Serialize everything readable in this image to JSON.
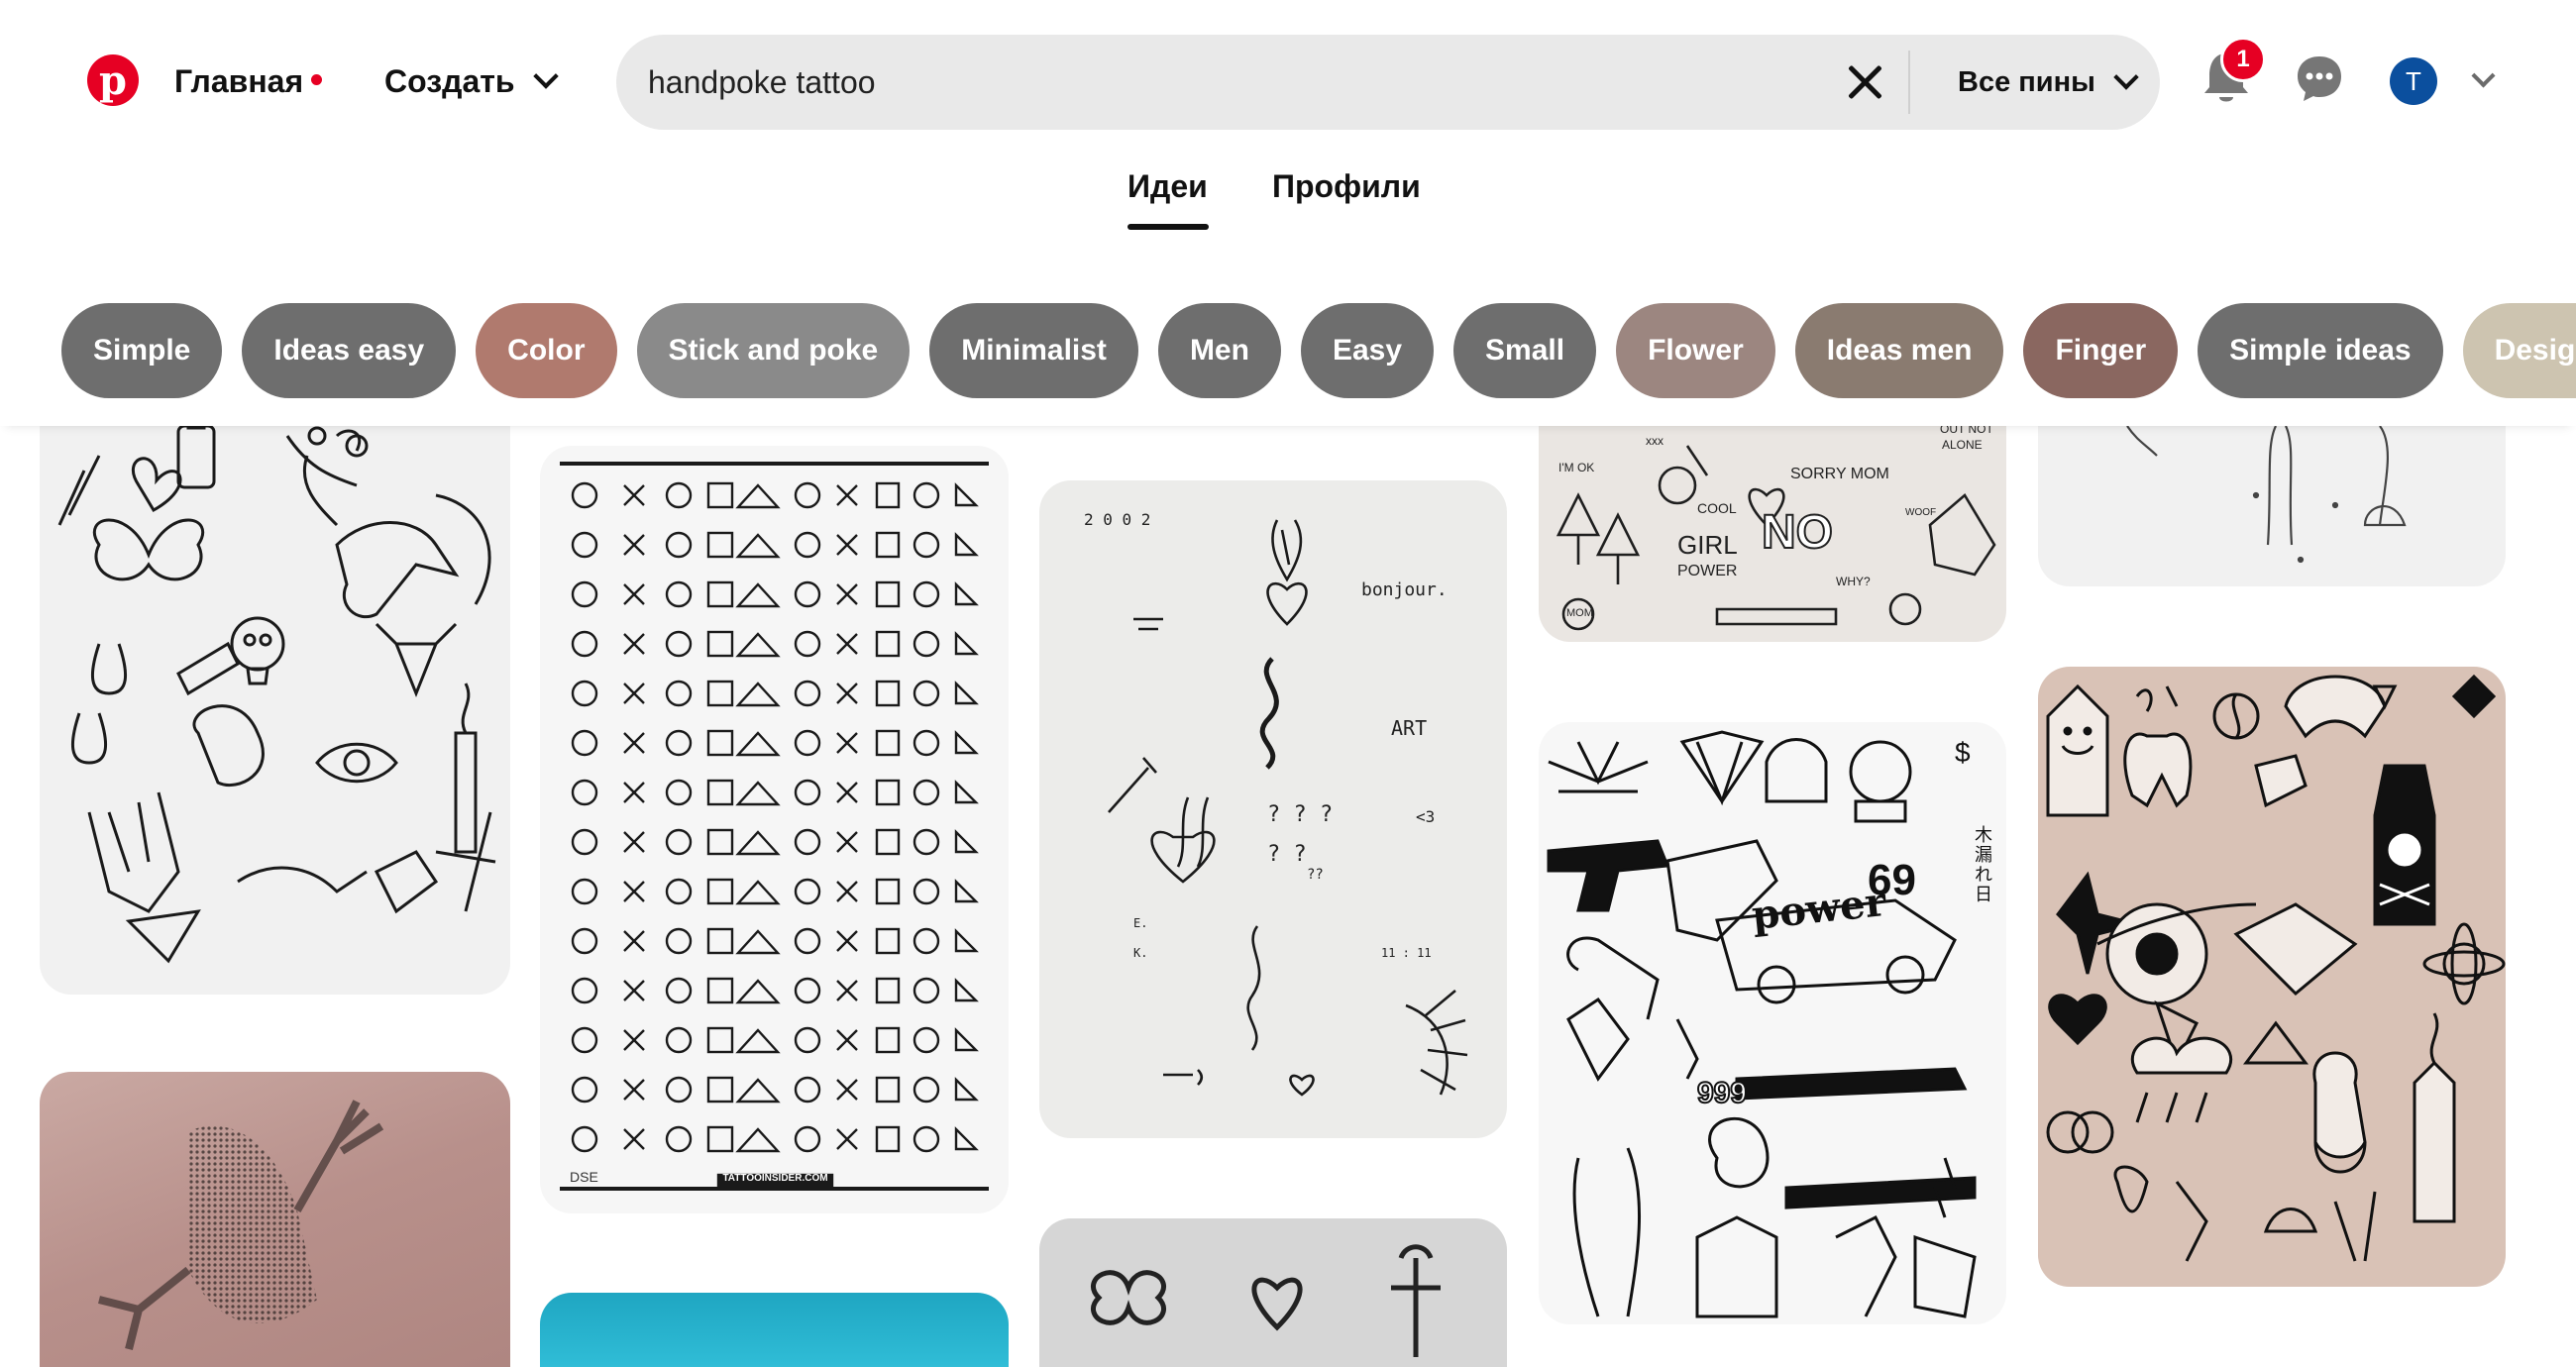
{
  "header": {
    "logo_icon": "pinterest-logo-icon",
    "nav_home": "Главная",
    "nav_create": "Создать",
    "search_value": "handpoke tattoo",
    "search_filter": "Все пины",
    "notification_count": "1",
    "avatar_initial": "T"
  },
  "tabs": [
    {
      "label": "Идеи",
      "selected": true
    },
    {
      "label": "Профили",
      "selected": false
    }
  ],
  "chips": [
    {
      "label": "Simple",
      "color": "#6e6e6e"
    },
    {
      "label": "Ideas easy",
      "color": "#6e6e6e"
    },
    {
      "label": "Color",
      "color": "#b07a6e"
    },
    {
      "label": "Stick and poke",
      "color": "#8a8a8a"
    },
    {
      "label": "Minimalist",
      "color": "#6e6e6e"
    },
    {
      "label": "Men",
      "color": "#6e6e6e"
    },
    {
      "label": "Easy",
      "color": "#6e6e6e"
    },
    {
      "label": "Small",
      "color": "#6e6e6e"
    },
    {
      "label": "Flower",
      "color": "#9c8680"
    },
    {
      "label": "Ideas men",
      "color": "#8a7b70"
    },
    {
      "label": "Finger",
      "color": "#8a6760"
    },
    {
      "label": "Simple ideas",
      "color": "#6e6e6e"
    },
    {
      "label": "Design",
      "color": "#cdc4b0"
    }
  ],
  "pins": {
    "sketch_sheet_texts": [
      "2 0 0 2",
      "bonjour.",
      "ART",
      "<3",
      "E.",
      "K.",
      "11 : 11",
      "? ? ?",
      "? ?",
      "??"
    ],
    "flash_sheet_footer": "TATTOOINSIDER.COM",
    "flash_sheet_initials": "DSE",
    "grunge_sheet_texts": [
      "SORRY MOM",
      "NO",
      "GIRL",
      "POWER",
      "COOL",
      "I'M OK",
      "xxx",
      "OUT NOT",
      "ALONE",
      "WHY?",
      "MOM",
      "WOOF"
    ],
    "anime_sheet_texts": [
      "power",
      "69",
      "999",
      "$",
      "木",
      "漏",
      "れ",
      "日"
    ]
  },
  "colors": {
    "brand": "#e60023",
    "avatar": "#0b4f9e",
    "pink_flash_bg": "#d9c2b6"
  }
}
